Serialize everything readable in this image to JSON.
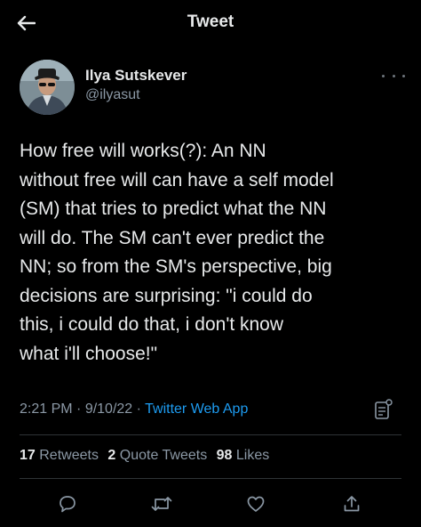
{
  "header": {
    "title": "Tweet",
    "back_icon": "arrow-left-icon"
  },
  "author": {
    "name": "Ilya Sutskever",
    "handle": "@ilyasut"
  },
  "tweet": {
    "text": "How free will works(?):  An NN\nwithout free will can have a self model\n(SM) that tries to predict what the NN\nwill do.  The SM can't ever predict the\nNN; so from the SM's perspective, big\ndecisions are surprising: \"i could do\nthis, i could do that, i don't know\nwhat i'll choose!\""
  },
  "meta": {
    "time": "2:21 PM",
    "separator": " · ",
    "date": "9/10/22",
    "source": "Twitter Web App"
  },
  "stats": {
    "retweets_count": "17",
    "retweets_label": "Retweets",
    "quotes_count": "2",
    "quotes_label": "Quote Tweets",
    "likes_count": "98",
    "likes_label": "Likes"
  },
  "actions": {
    "reply_icon": "reply-icon",
    "retweet_icon": "retweet-icon",
    "like_icon": "heart-icon",
    "share_icon": "share-icon"
  },
  "colors": {
    "background": "#000000",
    "text": "#e7e9ea",
    "muted": "#8b98a5",
    "link": "#1d9bf0",
    "divider": "#2f3336"
  }
}
